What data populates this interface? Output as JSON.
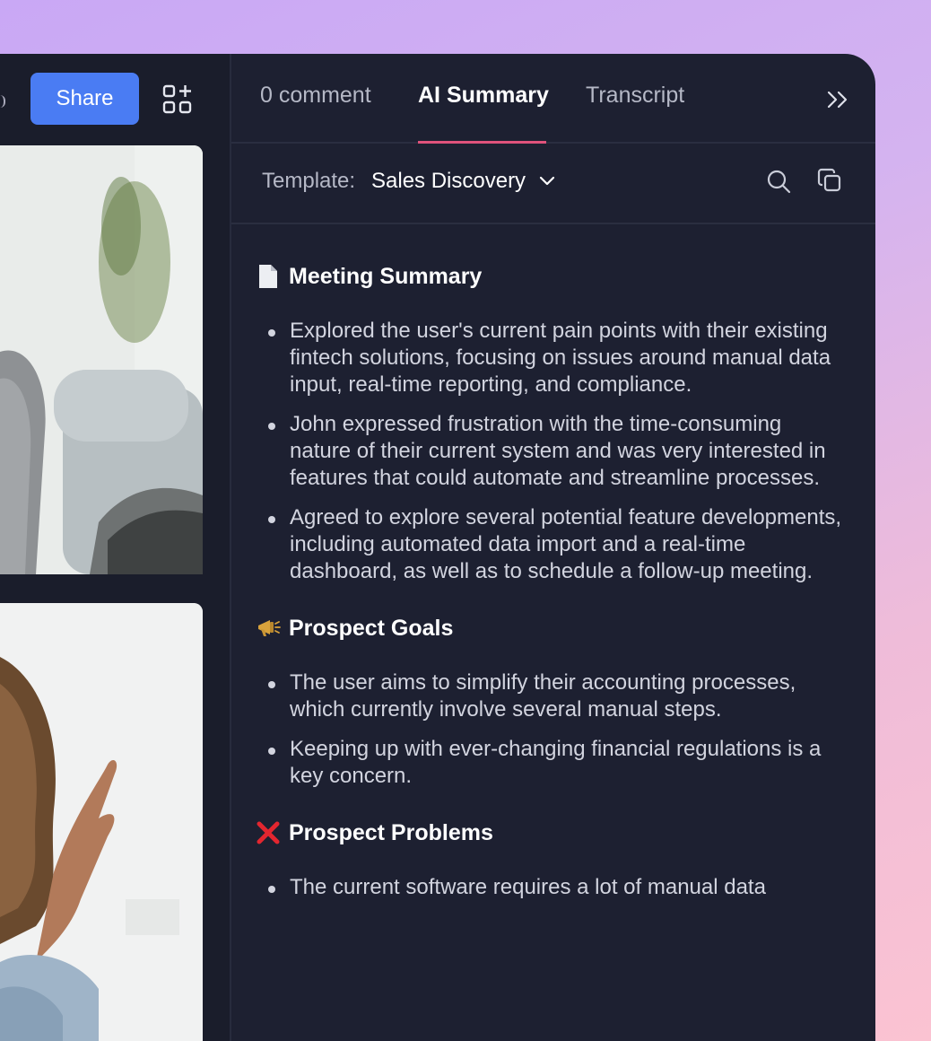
{
  "toolbar": {
    "share_label": "Share"
  },
  "tabs": [
    {
      "label": "0 comment"
    },
    {
      "label": "AI Summary"
    },
    {
      "label": "Transcript"
    }
  ],
  "template": {
    "label": "Template:",
    "value": "Sales Discovery"
  },
  "colors": {
    "accent": "#4a7cf3",
    "tab_underline": "#e0527b",
    "panel": "#1d2031"
  },
  "summary": {
    "meeting_summary": {
      "title": "Meeting Summary",
      "icon": "document-icon",
      "items": [
        "Explored the user's current pain points with their existing fintech solutions, focusing on issues around manual data input, real-time reporting, and compliance.",
        "John expressed frustration with the time-consuming nature of their current system and was very interested in features that could automate and streamline processes.",
        "Agreed to explore several potential feature developments, including automated data import and a real-time dashboard, as well as to schedule a follow-up meeting."
      ]
    },
    "prospect_goals": {
      "title": "Prospect Goals",
      "icon": "megaphone-icon",
      "items": [
        "The user aims to simplify their accounting processes, which currently involve several manual steps.",
        "Keeping up with ever-changing financial regulations is a key concern."
      ]
    },
    "prospect_problems": {
      "title": "Prospect Problems",
      "icon": "cross-mark-icon",
      "items": [
        "The current software requires a lot of manual data"
      ]
    }
  }
}
